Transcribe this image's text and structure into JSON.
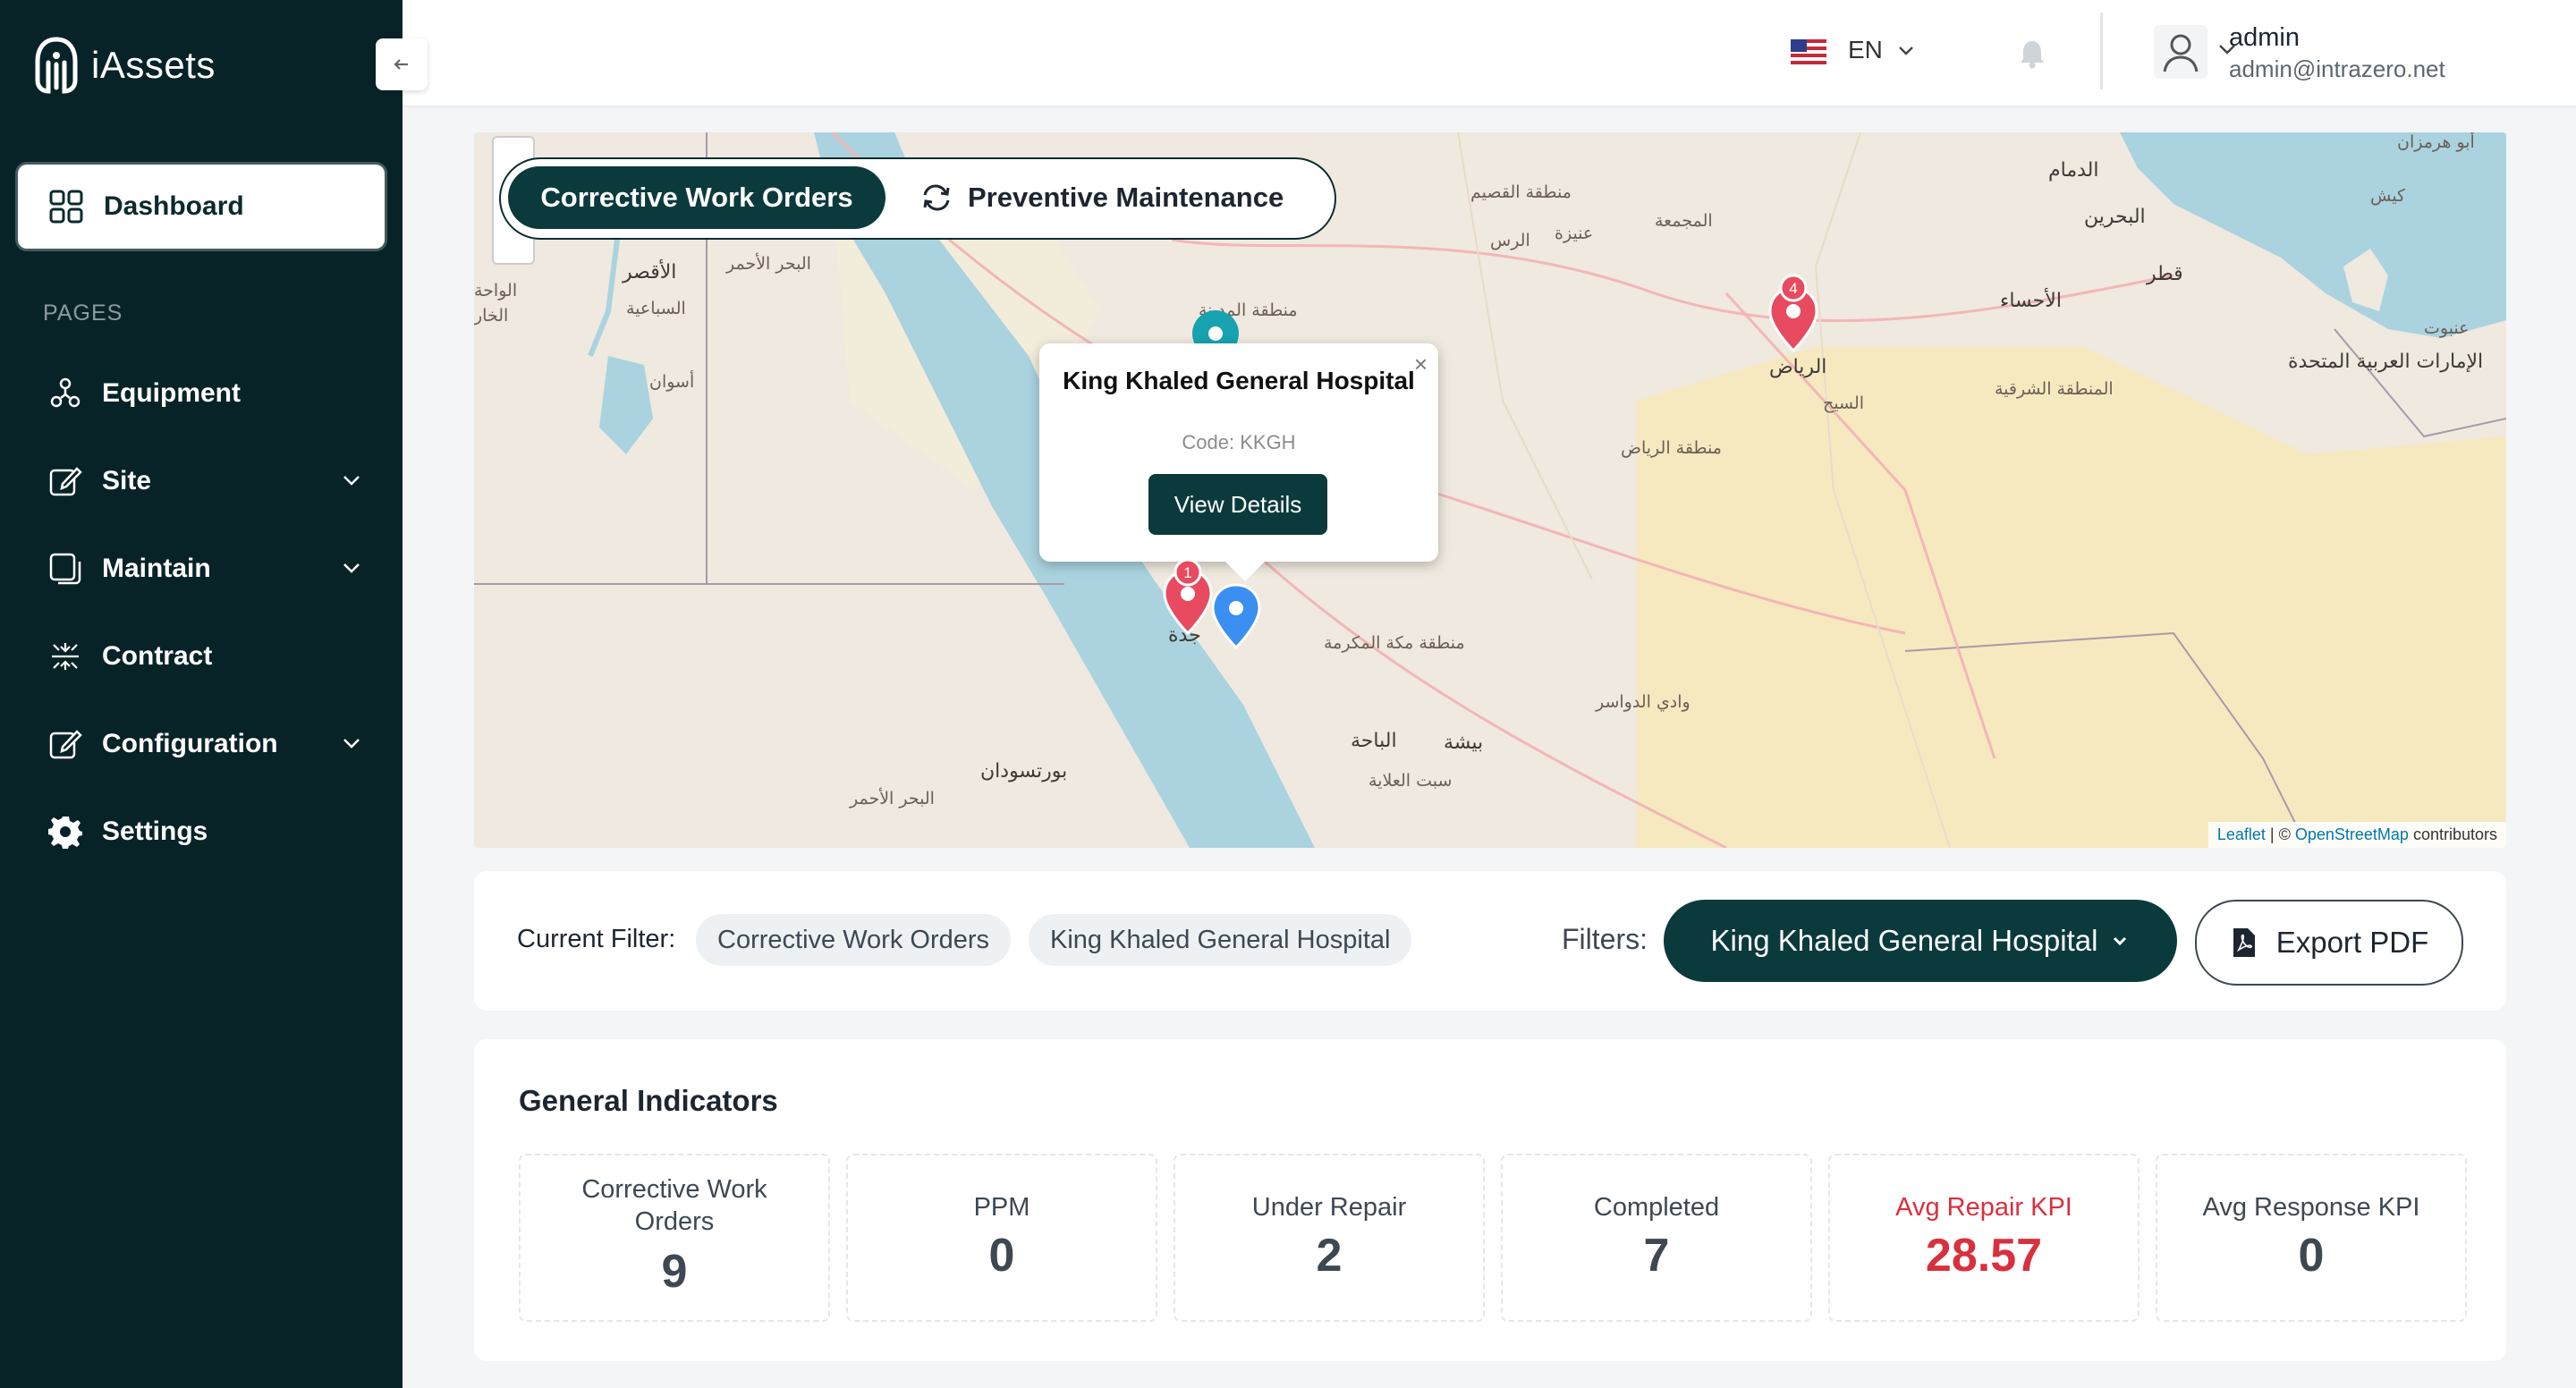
{
  "app": {
    "name": "iAssets"
  },
  "sidebar": {
    "active": {
      "label": "Dashboard",
      "icon": "grid-icon"
    },
    "section_label": "PAGES",
    "items": [
      {
        "label": "Equipment",
        "icon": "equipment-icon",
        "has_submenu": false
      },
      {
        "label": "Site",
        "icon": "edit-square-icon",
        "has_submenu": true
      },
      {
        "label": "Maintain",
        "icon": "copy-icon",
        "has_submenu": true
      },
      {
        "label": "Contract",
        "icon": "contract-icon",
        "has_submenu": false
      },
      {
        "label": "Configuration",
        "icon": "edit-square-icon",
        "has_submenu": true
      },
      {
        "label": "Settings",
        "icon": "gear-icon",
        "has_submenu": false
      }
    ]
  },
  "header": {
    "language": "EN",
    "user": {
      "name": "admin",
      "email": "admin@intrazero.net"
    }
  },
  "map": {
    "toggle": {
      "active": "Corrective Work Orders",
      "inactive": "Preventive Maintenance"
    },
    "popup": {
      "title": "King Khaled General Hospital",
      "code": "Code: KKGH",
      "button": "View Details"
    },
    "cluster_counts": [
      "1",
      "4"
    ],
    "labels": [
      "الدمام",
      "البحرين",
      "قطر",
      "الأحساء",
      "الرياض",
      "السيح",
      "المجمعة",
      "عنيزة",
      "الرس",
      "منطقة القصيم",
      "منطقة الرياض",
      "المنطقة الشرقية",
      "الإمارات العربية المتحدة",
      "كيش",
      "أبو هرمزان",
      "الأقصر",
      "السباعية",
      "أسوان",
      "البحر الأحمر",
      "منطقة مكة المكرمة",
      "جدة",
      "الباحة",
      "بيشة",
      "سبت العلاية",
      "وادي الدواسر",
      "بورتسودان",
      "البحر الأحمر",
      "الواحة",
      "الخار",
      "عنبوت",
      "منطقة المدينة"
    ],
    "attribution": {
      "leaflet": "Leaflet",
      "osm": "OpenStreetMap",
      "suffix": "contributors",
      "sep": " | © "
    }
  },
  "filters": {
    "current_label": "Current Filter:",
    "chips": [
      "Corrective Work Orders",
      "King Khaled General Hospital"
    ],
    "label": "Filters:",
    "selected": "King Khaled General Hospital",
    "export": "Export PDF"
  },
  "indicators": {
    "title": "General Indicators",
    "items": [
      {
        "label": "Corrective Work Orders",
        "value": "9"
      },
      {
        "label": "PPM",
        "value": "0"
      },
      {
        "label": "Under Repair",
        "value": "2"
      },
      {
        "label": "Completed",
        "value": "7"
      },
      {
        "label": "Avg Repair KPI",
        "value": "28.57",
        "highlight": "#d9303e"
      },
      {
        "label": "Avg Response KPI",
        "value": "0"
      }
    ]
  }
}
